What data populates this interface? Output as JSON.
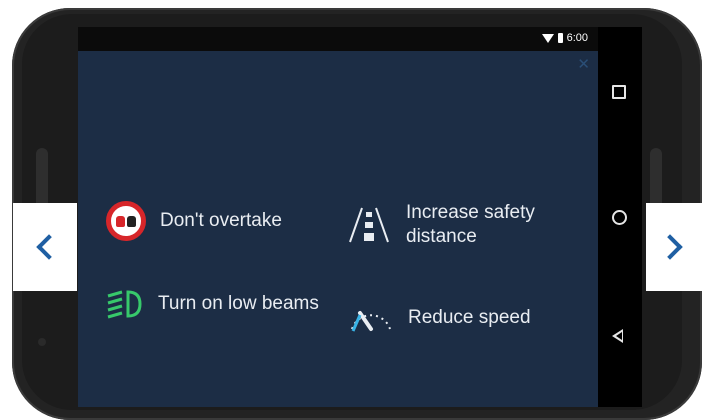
{
  "status_bar": {
    "time": "6:00",
    "icons": [
      "wifi-icon",
      "battery-icon"
    ]
  },
  "app": {
    "background_color": "#1c2d45",
    "close_icon": "close-icon",
    "items": [
      {
        "icon": "no-overtaking-icon",
        "label": "Don't overtake"
      },
      {
        "icon": "safety-distance-icon",
        "label_line1": "Increase safety",
        "label_line2": "distance"
      },
      {
        "icon": "low-beam-icon",
        "label": "Turn on low beams"
      },
      {
        "icon": "reduce-speed-icon",
        "label": "Reduce speed"
      }
    ]
  },
  "nav_bar": {
    "buttons": [
      "recents-square-icon",
      "home-circle-icon",
      "back-triangle-icon"
    ]
  },
  "carousel": {
    "prev_icon": "chevron-left-icon",
    "next_icon": "chevron-right-icon",
    "accent_color": "#1f5fa3"
  }
}
